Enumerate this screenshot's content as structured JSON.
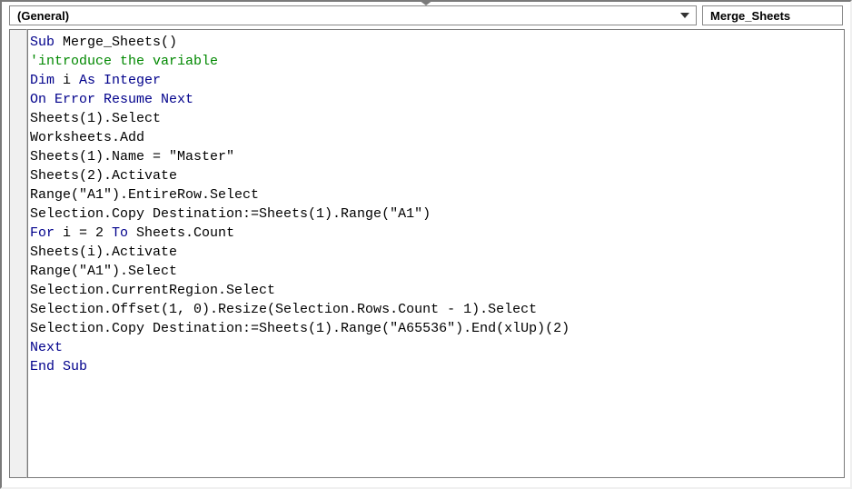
{
  "dropdowns": {
    "object": "(General)",
    "procedure": "Merge_Sheets"
  },
  "code": {
    "lines": [
      {
        "segments": [
          {
            "text": "Sub ",
            "class": "kw"
          },
          {
            "text": "Merge_Sheets()",
            "class": "plain"
          }
        ]
      },
      {
        "segments": [
          {
            "text": "'introduce the variable",
            "class": "comment"
          }
        ]
      },
      {
        "segments": [
          {
            "text": "Dim ",
            "class": "kw"
          },
          {
            "text": "i ",
            "class": "plain"
          },
          {
            "text": "As Integer",
            "class": "kw"
          }
        ]
      },
      {
        "segments": [
          {
            "text": "On Error Resume Next",
            "class": "kw"
          }
        ]
      },
      {
        "segments": [
          {
            "text": "Sheets(1).Select",
            "class": "plain"
          }
        ]
      },
      {
        "segments": [
          {
            "text": "Worksheets.Add",
            "class": "plain"
          }
        ]
      },
      {
        "segments": [
          {
            "text": "Sheets(1).Name = \"Master\"",
            "class": "plain"
          }
        ]
      },
      {
        "segments": [
          {
            "text": "Sheets(2).Activate",
            "class": "plain"
          }
        ]
      },
      {
        "segments": [
          {
            "text": "Range(\"A1\").EntireRow.Select",
            "class": "plain"
          }
        ]
      },
      {
        "segments": [
          {
            "text": "Selection.Copy Destination:=Sheets(1).Range(\"A1\")",
            "class": "plain"
          }
        ]
      },
      {
        "segments": [
          {
            "text": "For ",
            "class": "kw"
          },
          {
            "text": "i = 2 ",
            "class": "plain"
          },
          {
            "text": "To ",
            "class": "kw"
          },
          {
            "text": "Sheets.Count",
            "class": "plain"
          }
        ]
      },
      {
        "segments": [
          {
            "text": "Sheets(i).Activate",
            "class": "plain"
          }
        ]
      },
      {
        "segments": [
          {
            "text": "Range(\"A1\").Select",
            "class": "plain"
          }
        ]
      },
      {
        "segments": [
          {
            "text": "Selection.CurrentRegion.Select",
            "class": "plain"
          }
        ]
      },
      {
        "segments": [
          {
            "text": "Selection.Offset(1, 0).Resize(Selection.Rows.Count - 1).Select",
            "class": "plain"
          }
        ]
      },
      {
        "segments": [
          {
            "text": "Selection.Copy Destination:=Sheets(1).Range(\"A65536\").End(xlUp)(2)",
            "class": "plain"
          }
        ]
      },
      {
        "segments": [
          {
            "text": "Next",
            "class": "kw"
          }
        ]
      },
      {
        "segments": [
          {
            "text": "End Sub",
            "class": "kw"
          }
        ]
      }
    ]
  }
}
